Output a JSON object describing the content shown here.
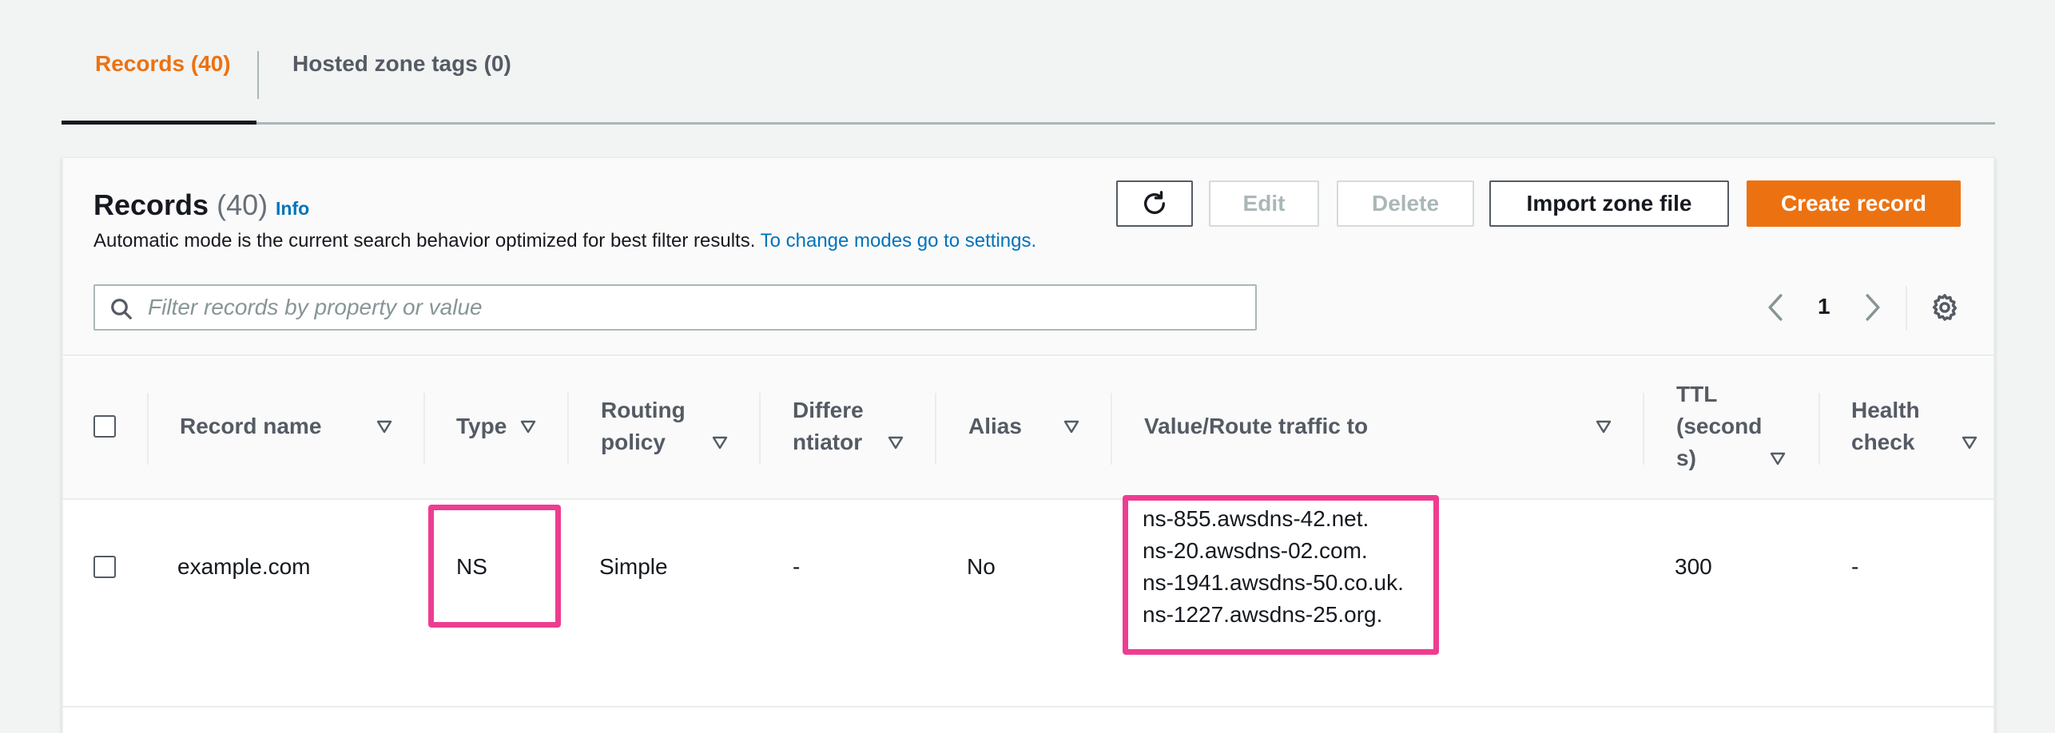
{
  "tabs": [
    {
      "label": "Records (40)",
      "active": true
    },
    {
      "label": "Hosted zone tags (0)",
      "active": false
    }
  ],
  "panel": {
    "title": "Records",
    "count": "(40)",
    "info_label": "Info",
    "description": "Automatic mode is the current search behavior optimized for best filter results.",
    "settings_link": "To change modes go to settings."
  },
  "toolbar": {
    "refresh_icon": "refresh-icon",
    "edit_label": "Edit",
    "delete_label": "Delete",
    "import_label": "Import zone file",
    "create_label": "Create record"
  },
  "search": {
    "placeholder": "Filter records by property or value"
  },
  "pagination": {
    "current_page": "1"
  },
  "columns": [
    {
      "line1": "Record name",
      "line2": "",
      "line3": ""
    },
    {
      "line1": "Type",
      "line2": "",
      "line3": ""
    },
    {
      "line1": "Routing",
      "line2": "policy",
      "line3": ""
    },
    {
      "line1": "Differe",
      "line2": "ntiator",
      "line3": ""
    },
    {
      "line1": "Alias",
      "line2": "",
      "line3": ""
    },
    {
      "line1": "Value/Route traffic to",
      "line2": "",
      "line3": ""
    },
    {
      "line1": "TTL",
      "line2": "(second",
      "line3": "s)"
    },
    {
      "line1": "Health",
      "line2": "check",
      "line3": ""
    }
  ],
  "rows": [
    {
      "record_name": "example.com",
      "type": "NS",
      "routing_policy": "Simple",
      "differentiator": "-",
      "alias": "No",
      "values": [
        "ns-855.awsdns-42.net.",
        "ns-20.awsdns-02.com.",
        "ns-1941.awsdns-50.co.uk.",
        "ns-1227.awsdns-25.org."
      ],
      "ttl": "300",
      "health_check": "-"
    }
  ],
  "colors": {
    "accent": "#ec7211",
    "link": "#0073bb",
    "highlight": "#ee3d91",
    "text": "#16191f",
    "muted": "#545b64"
  }
}
